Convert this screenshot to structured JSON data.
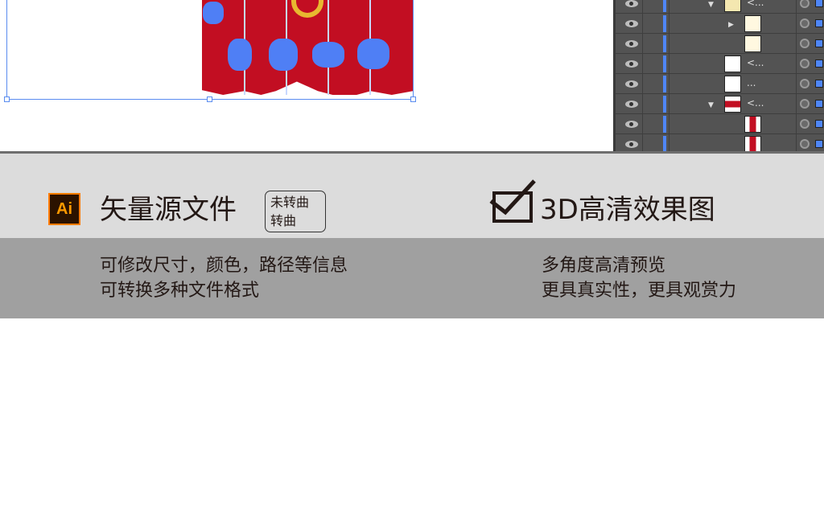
{
  "layers_panel": {
    "rows": [
      {
        "expand": "down",
        "name": "<..."
      },
      {
        "expand": "right",
        "name": ""
      },
      {
        "expand": "",
        "name": ""
      },
      {
        "expand": "",
        "name": "<..."
      },
      {
        "expand": "",
        "name": "..."
      },
      {
        "expand": "down",
        "name": "<..."
      },
      {
        "expand": "",
        "name": ""
      },
      {
        "expand": "",
        "name": ""
      }
    ]
  },
  "left_feature": {
    "icon": "Ai",
    "title": "矢量源文件",
    "tag_lines": [
      "未转曲",
      "转曲"
    ],
    "lines": [
      "可修改尺寸，颜色，路径等信息",
      "可转换多种文件格式"
    ]
  },
  "right_feature": {
    "icon": "checkbox-checked-icon",
    "title": "3D高清效果图",
    "lines": [
      "多角度高清预览",
      "更具真实性，更具观赏力"
    ]
  },
  "colors": {
    "accent_red": "#c20e22",
    "selection_blue": "#4f86f7",
    "ai_orange": "#ff7c00"
  }
}
